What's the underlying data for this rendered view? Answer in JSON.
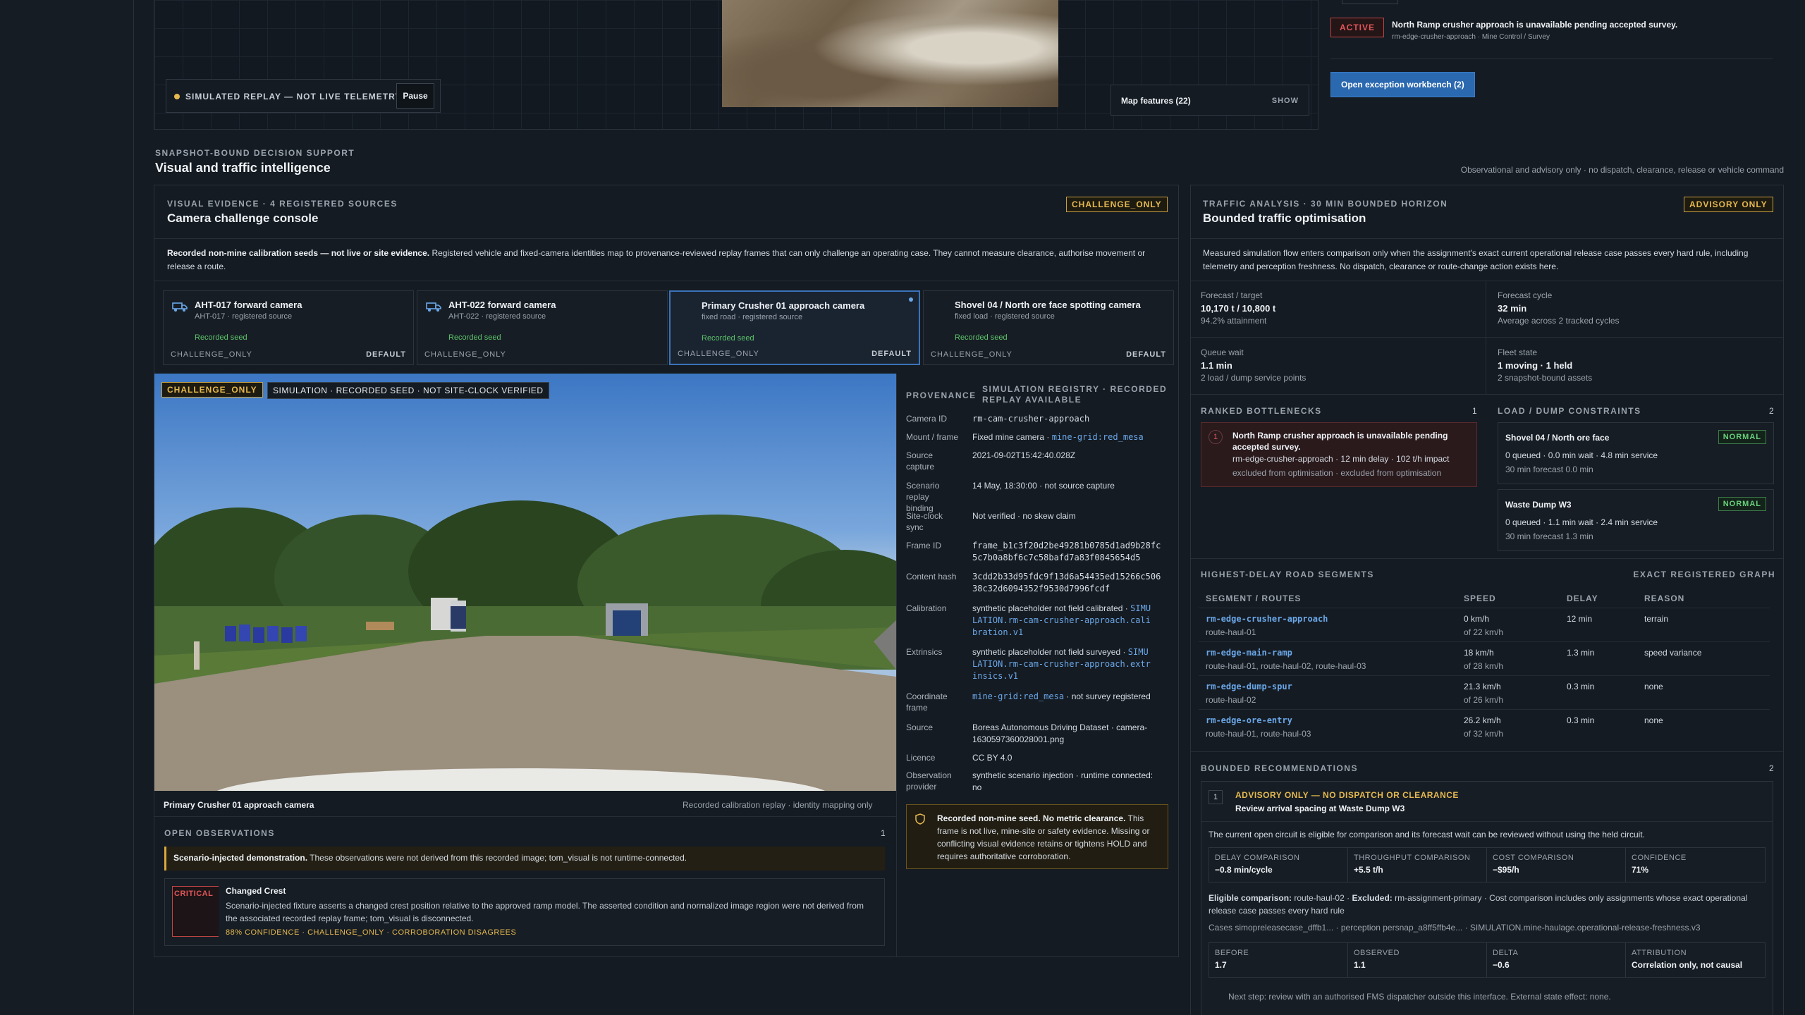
{
  "top": {
    "sim_badge": "SIMULATED REPLAY — NOT LIVE TELEMETRY",
    "pause_label": "Pause",
    "map_features_label": "Map features (22)",
    "map_features_action": "SHOW",
    "exception_tag": "ACTIVE",
    "exception_title": "North Ramp crusher approach is unavailable pending accepted survey.",
    "exception_sub": "rm-edge-crusher-approach · Mine Control / Survey",
    "open_exception_label": "Open exception workbench (2)"
  },
  "section": {
    "eyebrow": "SNAPSHOT-BOUND DECISION SUPPORT",
    "title": "Visual and traffic intelligence",
    "note": "Observational and advisory only · no dispatch, clearance, release or vehicle command"
  },
  "visual": {
    "eyebrow": "VISUAL EVIDENCE · 4 REGISTERED SOURCES",
    "title": "Camera challenge console",
    "tag": "CHALLENGE_ONLY",
    "intro_bold": "Recorded non-mine calibration seeds — not live or site evidence.",
    "intro_rest": "Registered vehicle and fixed-camera identities map to provenance-reviewed replay frames that can only challenge an operating case. They cannot measure clearance, authorise movement or release a route.",
    "cameras": [
      {
        "name": "AHT-017 forward camera",
        "sub": "AHT-017 · registered source",
        "seed": "Recorded seed",
        "challenge": "CHALLENGE_ONLY",
        "default": "DEFAULT"
      },
      {
        "name": "AHT-022 forward camera",
        "sub": "AHT-022 · registered source",
        "seed": "Recorded seed",
        "challenge": "CHALLENGE_ONLY",
        "default": ""
      },
      {
        "name": "Primary Crusher 01 approach camera",
        "sub": "fixed road · registered source",
        "seed": "Recorded seed",
        "challenge": "CHALLENGE_ONLY",
        "default": "DEFAULT"
      },
      {
        "name": "Shovel 04 / North ore face spotting camera",
        "sub": "fixed load · registered source",
        "seed": "Recorded seed",
        "challenge": "CHALLENGE_ONLY",
        "default": "DEFAULT"
      }
    ],
    "frame_tag1": "CHALLENGE_ONLY",
    "frame_tag2": "SIMULATION · RECORDED SEED · NOT SITE-CLOCK VERIFIED",
    "caption_left": "Primary Crusher 01 approach camera",
    "caption_right": "Recorded calibration replay · identity mapping only",
    "provenance": {
      "title": "PROVENANCE",
      "registry": "SIMULATION REGISTRY · RECORDED REPLAY AVAILABLE",
      "rows": [
        {
          "label": "Camera ID",
          "value": "rm-cam-crusher-approach"
        },
        {
          "label": "Mount / frame",
          "value": "Fixed mine camera · ",
          "link": "mine-grid:red_mesa"
        },
        {
          "label": "Source capture",
          "value": "2021-09-02T15:42:40.028Z"
        },
        {
          "label": "Scenario replay binding",
          "value": "14 May, 18:30:00 · not source capture"
        },
        {
          "label": "Site-clock sync",
          "value": "Not verified · no skew claim"
        },
        {
          "label": "Frame ID",
          "value": "frame_b1c3f20d2be49281b0785d1ad9b28fc5c7b0a8bf6c7c58bafd7a83f0845654d5"
        },
        {
          "label": "Content hash",
          "value": "3cdd2b33d95fdc9f13d6a54435ed15266c50638c32d6094352f9530d7996fcdf"
        },
        {
          "label": "Calibration",
          "value": "synthetic placeholder not field calibrated · ",
          "link": "SIMULATION.rm-cam-crusher-approach.calibration.v1"
        },
        {
          "label": "Extrinsics",
          "value": "synthetic placeholder not field surveyed · ",
          "link": "SIMULATION.rm-cam-crusher-approach.extrinsics.v1"
        },
        {
          "label": "Coordinate frame",
          "link": "mine-grid:red_mesa",
          "value": " · not survey registered"
        },
        {
          "label": "Source",
          "value": "Boreas Autonomous Driving Dataset · camera-1630597360028001.png"
        },
        {
          "label": "Licence",
          "value": "CC BY 4.0"
        },
        {
          "label": "Observation provider",
          "value": "synthetic scenario injection · runtime connected: no"
        }
      ],
      "warning_bold": "Recorded non-mine seed. No metric clearance.",
      "warning_rest": "This frame is not live, mine-site or safety evidence. Missing or conflicting visual evidence retains or tightens HOLD and requires authoritative corroboration."
    },
    "observations": {
      "title": "OPEN OBSERVATIONS",
      "count": "1",
      "banner_bold": "Scenario-injected demonstration.",
      "banner_rest": "These observations were not derived from this recorded image; tom_visual is not runtime-connected.",
      "item_severity": "CRITICAL",
      "item_title": "Changed Crest",
      "item_text": "Scenario-injected fixture asserts a changed crest position relative to the approved ramp model. The asserted condition and normalized image region were not derived from the associated recorded replay frame; tom_visual is disconnected.",
      "item_meta": "88% CONFIDENCE · CHALLENGE_ONLY · CORROBORATION DISAGREES"
    }
  },
  "traffic": {
    "eyebrow": "TRAFFIC ANALYSIS · 30 MIN BOUNDED HORIZON",
    "title": "Bounded traffic optimisation",
    "tag": "ADVISORY ONLY",
    "intro": "Measured simulation flow enters comparison only when the assignment's exact current operational release case passes every hard rule, including telemetry and perception freshness. No dispatch, clearance or route-change action exists here.",
    "metrics": [
      {
        "label": "Forecast / target",
        "value": "10,170 t / 10,800 t",
        "sub": "94.2% attainment"
      },
      {
        "label": "Forecast cycle",
        "value": "32 min",
        "sub": "Average across 2 tracked cycles"
      },
      {
        "label": "Queue wait",
        "value": "1.1 min",
        "sub": "2 load / dump service points"
      },
      {
        "label": "Fleet state",
        "value": "1 moving · 1 held",
        "sub": "2 snapshot-bound assets"
      }
    ],
    "bottlenecks": {
      "title": "RANKED BOTTLENECKS",
      "count": "1",
      "rank": "1",
      "item_title": "North Ramp crusher approach is unavailable pending accepted survey.",
      "item_line": "rm-edge-crusher-approach · 12 min delay · 102 t/h impact",
      "item_sub": "excluded from optimisation · excluded from optimisation"
    },
    "constraints": {
      "title": "LOAD / DUMP CONSTRAINTS",
      "count": "2",
      "items": [
        {
          "name": "Shovel 04 / North ore face",
          "status": "NORMAL",
          "line": "0 queued · 0.0 min wait · 4.8 min service",
          "sub": "30 min forecast 0.0 min"
        },
        {
          "name": "Waste Dump W3",
          "status": "NORMAL",
          "line": "0 queued · 1.1 min wait · 2.4 min service",
          "sub": "30 min forecast 1.3 min"
        }
      ]
    },
    "segments": {
      "title": "HIGHEST-DELAY ROAD SEGMENTS",
      "graph": "EXACT REGISTERED GRAPH",
      "headers": [
        "SEGMENT / ROUTES",
        "SPEED",
        "DELAY",
        "REASON"
      ],
      "rows": [
        {
          "seg": "rm-edge-crusher-approach",
          "routes": "route-haul-01",
          "speed": "0 km/h",
          "of": "of 22 km/h",
          "delay": "12 min",
          "reason": "terrain"
        },
        {
          "seg": "rm-edge-main-ramp",
          "routes": "route-haul-01, route-haul-02, route-haul-03",
          "speed": "18 km/h",
          "of": "of 28 km/h",
          "delay": "1.3 min",
          "reason": "speed variance"
        },
        {
          "seg": "rm-edge-dump-spur",
          "routes": "route-haul-02",
          "speed": "21.3 km/h",
          "of": "of 26 km/h",
          "delay": "0.3 min",
          "reason": "none"
        },
        {
          "seg": "rm-edge-ore-entry",
          "routes": "route-haul-01, route-haul-03",
          "speed": "26.2 km/h",
          "of": "of 32 km/h",
          "delay": "0.3 min",
          "reason": "none"
        }
      ]
    },
    "recommendations": {
      "title": "BOUNDED RECOMMENDATIONS",
      "count": "2",
      "rank": "1",
      "advisory": "ADVISORY ONLY — NO DISPATCH OR CLEARANCE",
      "rec_title": "Review arrival spacing at Waste Dump W3",
      "text": "The current open circuit is eligible for comparison and its forecast wait can be reviewed without using the held circuit.",
      "comparisons": [
        {
          "label": "DELAY COMPARISON",
          "value": "−0.8 min/cycle"
        },
        {
          "label": "THROUGHPUT COMPARISON",
          "value": "+5.5 t/h"
        },
        {
          "label": "COST COMPARISON",
          "value": "−$95/h"
        },
        {
          "label": "CONFIDENCE",
          "value": "71%"
        }
      ],
      "eligible_bold": "Eligible comparison:",
      "eligible_1": "route-haul-02 ·",
      "excluded_bold": "Excluded:",
      "eligible_2": "rm-assignment-primary · Cost comparison includes only assignments whose exact operational release case passes every hard rule",
      "cases": "Cases simopreleasecase_dffb1... · perception persnap_a8ff5ffb4e... · SIMULATION.mine-haulage.operational-release-freshness.v3",
      "outcomes": [
        {
          "label": "BEFORE",
          "value": "1.7"
        },
        {
          "label": "OBSERVED",
          "value": "1.1"
        },
        {
          "label": "DELTA",
          "value": "−0.6"
        },
        {
          "label": "ATTRIBUTION",
          "value": "Correlation only, not causal"
        }
      ],
      "next_step": "Next step: review with an authorised FMS dispatcher outside this interface. External state effect: none."
    }
  }
}
